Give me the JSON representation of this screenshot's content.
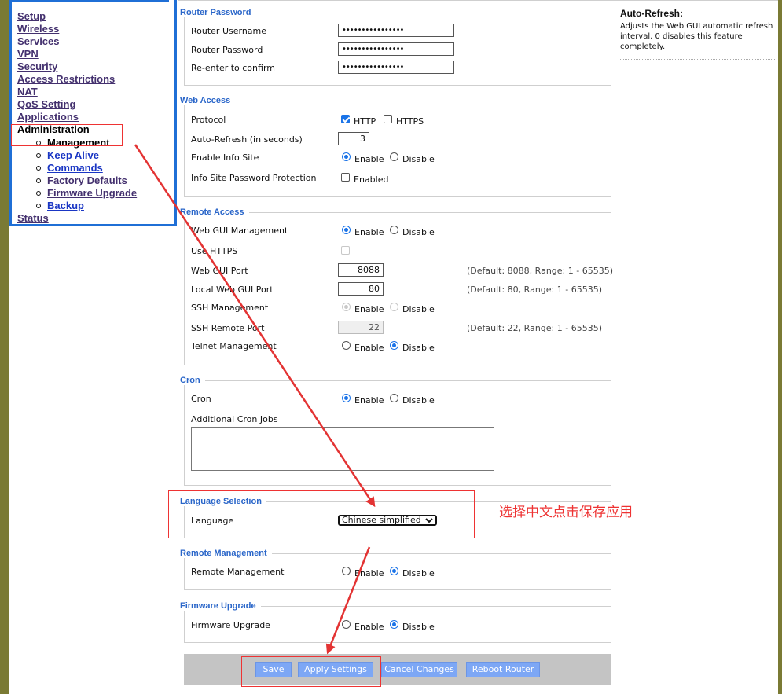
{
  "sidebar": {
    "items": [
      {
        "label": "Setup"
      },
      {
        "label": "Wireless"
      },
      {
        "label": "Services"
      },
      {
        "label": "VPN"
      },
      {
        "label": "Security"
      },
      {
        "label": "Access Restrictions"
      },
      {
        "label": "NAT"
      },
      {
        "label": "QoS Setting"
      },
      {
        "label": "Applications"
      },
      {
        "label": "Administration"
      },
      {
        "label": "Status"
      }
    ],
    "submenu": [
      {
        "label": "Management"
      },
      {
        "label": "Keep Alive"
      },
      {
        "label": "Commands"
      },
      {
        "label": "Factory Defaults"
      },
      {
        "label": "Firmware Upgrade"
      },
      {
        "label": "Backup"
      }
    ]
  },
  "router_password": {
    "title": "Router Password",
    "username_label": "Router Username",
    "username_value": "••••••••••••••••",
    "password_label": "Router Password",
    "password_value": "••••••••••••••••",
    "confirm_label": "Re-enter to confirm",
    "confirm_value": "••••••••••••••••"
  },
  "web_access": {
    "title": "Web Access",
    "protocol_label": "Protocol",
    "http_label": "HTTP",
    "http_checked": true,
    "https_label": "HTTPS",
    "https_checked": false,
    "autorefresh_label": "Auto-Refresh (in seconds)",
    "autorefresh_value": "3",
    "infosite_label": "Enable Info Site",
    "enable_label": "Enable",
    "disable_label": "Disable",
    "infosite_pw_label": "Info Site Password Protection",
    "enabled_label": "Enabled"
  },
  "remote_access": {
    "title": "Remote Access",
    "webgui_label": "Web GUI Management",
    "enable_label": "Enable",
    "disable_label": "Disable",
    "use_https_label": "Use HTTPS",
    "webgui_port_label": "Web GUI Port",
    "webgui_port_value": "8088",
    "webgui_port_hint": "(Default: 8088, Range: 1 - 65535)",
    "local_port_label": "Local Web GUI Port",
    "local_port_value": "80",
    "local_port_hint": "(Default: 80, Range: 1 - 65535)",
    "ssh_label": "SSH Management",
    "ssh_port_label": "SSH Remote Port",
    "ssh_port_value": "22",
    "ssh_port_hint": "(Default: 22, Range: 1 - 65535)",
    "telnet_label": "Telnet Management"
  },
  "cron": {
    "title": "Cron",
    "cron_label": "Cron",
    "enable_label": "Enable",
    "disable_label": "Disable",
    "jobs_label": "Additional Cron Jobs",
    "jobs_value": ""
  },
  "language": {
    "title": "Language Selection",
    "label": "Language",
    "selected": "Chinese simplified"
  },
  "remote_mgmt": {
    "title": "Remote Management",
    "label": "Remote Management",
    "enable_label": "Enable",
    "disable_label": "Disable"
  },
  "firmware": {
    "title": "Firmware Upgrade",
    "label": "Firmware Upgrade",
    "enable_label": "Enable",
    "disable_label": "Disable"
  },
  "buttons": {
    "save": "Save",
    "apply": "Apply Settings",
    "cancel": "Cancel Changes",
    "reboot": "Reboot Router"
  },
  "help": {
    "title": "Auto-Refresh:",
    "text": "Adjusts the Web GUI automatic refresh interval. 0 disables this feature completely."
  },
  "annotation": {
    "text": "选择中文点击保存应用",
    "color": "#e33333"
  },
  "colors": {
    "accent": "#2a66c9",
    "sidebar_border": "#1f6fd6",
    "olive": "#7a7a34",
    "button": "#7da7f5"
  }
}
